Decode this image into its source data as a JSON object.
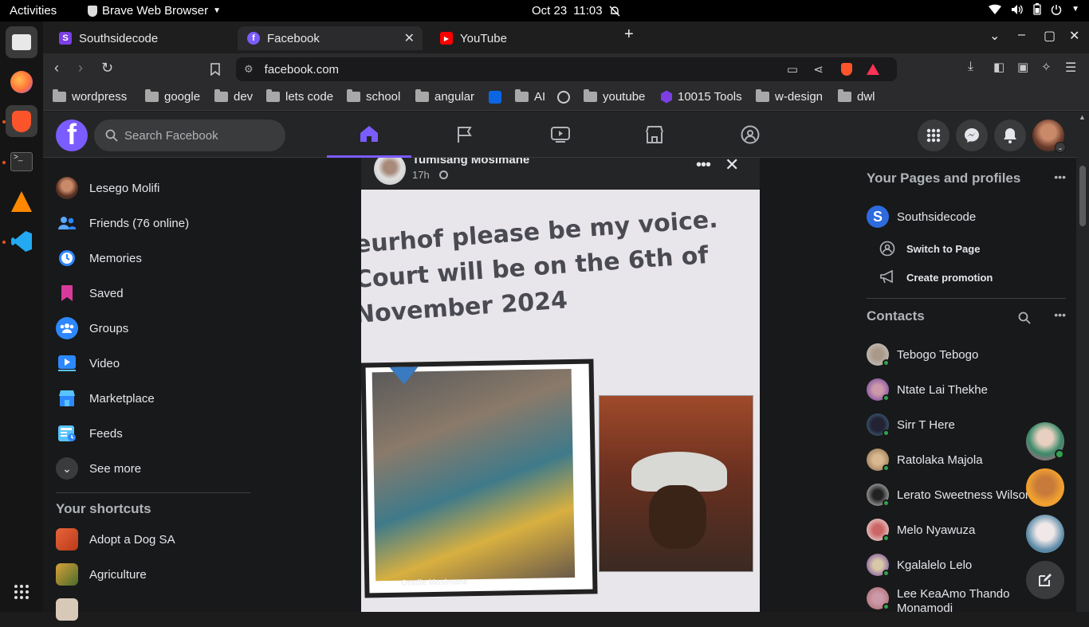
{
  "system_bar": {
    "activities": "Activities",
    "app_name": "Brave Web Browser",
    "date": "Oct 23",
    "time": "11:03"
  },
  "tabs": [
    {
      "label": "Southsidecode",
      "favicon": "S",
      "color": "#7b3fe4"
    },
    {
      "label": "Facebook",
      "favicon": "f",
      "color": "#7b5cff"
    },
    {
      "label": "YouTube",
      "favicon": "▶",
      "color": "#ff0000"
    }
  ],
  "address_bar": {
    "url": "facebook.com"
  },
  "bookmarks": [
    "wordpress",
    "google",
    "dev",
    "lets code",
    "school",
    "angular",
    "AI",
    "youtube",
    "10015 Tools",
    "w-design",
    "dwl"
  ],
  "facebook": {
    "search_placeholder": "Search Facebook",
    "left_menu": [
      {
        "label": "Lesego Molifi",
        "icon": "profile-avatar"
      },
      {
        "label": "Friends (76 online)",
        "icon": "friends-icon"
      },
      {
        "label": "Memories",
        "icon": "memories-icon"
      },
      {
        "label": "Saved",
        "icon": "saved-icon"
      },
      {
        "label": "Groups",
        "icon": "groups-icon"
      },
      {
        "label": "Video",
        "icon": "video-icon"
      },
      {
        "label": "Marketplace",
        "icon": "marketplace-icon"
      },
      {
        "label": "Feeds",
        "icon": "feeds-icon"
      },
      {
        "label": "See more",
        "icon": "chevron-down-icon"
      }
    ],
    "shortcuts_title": "Your shortcuts",
    "shortcuts": [
      "Adopt a Dog SA",
      "Agriculture"
    ],
    "post": {
      "author": "Tumisang Mosimane",
      "time": "17h",
      "photo_text": [
        "eurhof please be my voice.",
        "Court will be on the 6th of",
        "November 2024"
      ],
      "caption": "Oratile Mosimane"
    },
    "pages_title": "Your Pages and profiles",
    "page_name": "Southsidecode",
    "page_actions": [
      "Switch to Page",
      "Create promotion"
    ],
    "contacts_title": "Contacts",
    "contacts": [
      "Tebogo Tebogo",
      "Ntate Lai Thekhe",
      "Sirr T Here",
      "Ratolaka Majola",
      "Lerato Sweetness Wilson",
      "Melo Nyawuza",
      "Kgalalelo Lelo",
      "Lee KeaAmo Thando Monamodi"
    ]
  }
}
